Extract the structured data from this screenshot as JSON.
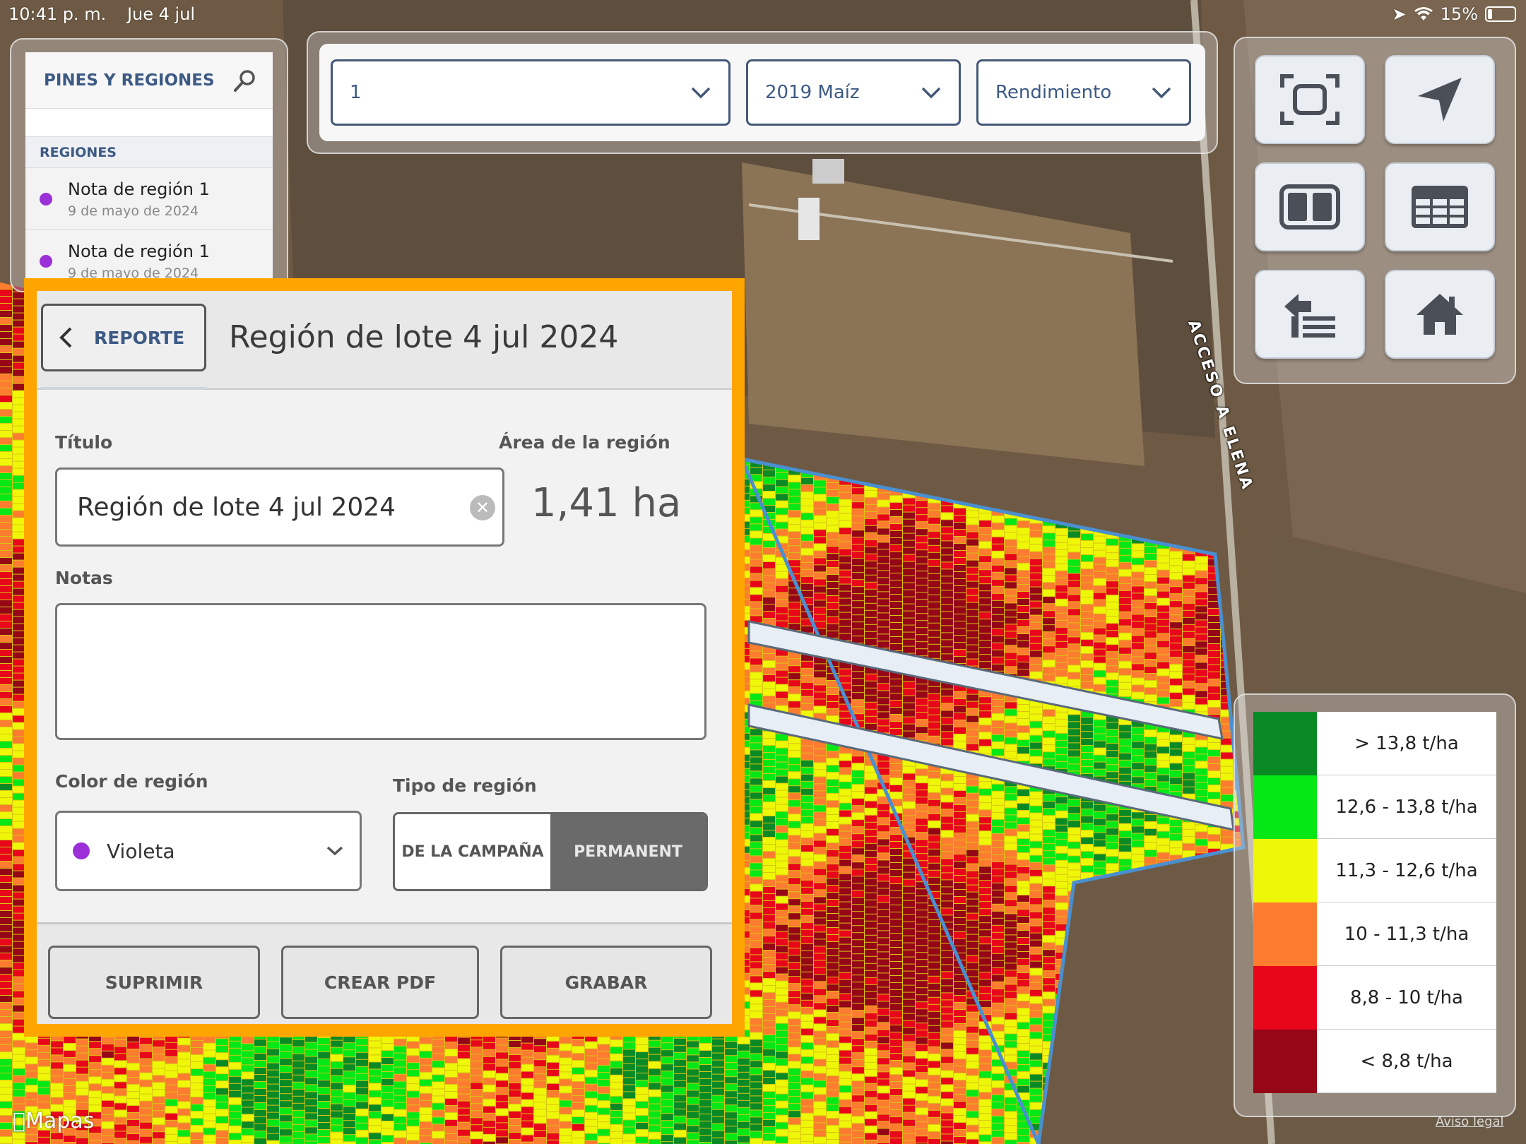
{
  "status_bar": {
    "time": "10:41 p. m.",
    "date": "Jue 4 jul",
    "battery": "15%"
  },
  "pins_panel": {
    "title": "PINES Y REGIONES",
    "regions_header": "REGIONES",
    "items": [
      {
        "name": "Nota de región 1",
        "date": "9 de mayo de 2024",
        "color": "#9b30d9"
      },
      {
        "name": "Nota de región 1",
        "date": "9 de mayo de 2024",
        "color": "#9b30d9"
      }
    ]
  },
  "selectors": {
    "field": "1",
    "season": "2019 Maíz",
    "layer": "Rendimiento"
  },
  "tools": [
    "fullscreen-icon",
    "navigate-icon",
    "split-view-icon",
    "table-icon",
    "export-list-icon",
    "home-icon"
  ],
  "legend": [
    {
      "label": "> 13,8 t/ha",
      "color": "#0a8a25"
    },
    {
      "label": "12,6 - 13,8 t/ha",
      "color": "#05e816"
    },
    {
      "label": "11,3 - 12,6 t/ha",
      "color": "#eef707"
    },
    {
      "label": "10 - 11,3 t/ha",
      "color": "#fd7c2f"
    },
    {
      "label": "8,8 - 10 t/ha",
      "color": "#e8061b"
    },
    {
      "label": "< 8,8 t/ha",
      "color": "#950617"
    }
  ],
  "map": {
    "road_label": "ACCESO A ELENA",
    "provider": "Mapas",
    "legal": "Aviso legal"
  },
  "dialog": {
    "back_label": "REPORTE",
    "header_title": "Región de lote 4 jul 2024",
    "title_label": "Título",
    "title_value": "Región de lote 4 jul 2024",
    "area_label": "Área de la región",
    "area_value": "1,41 ha",
    "notes_label": "Notas",
    "notes_value": "",
    "color_label": "Color de región",
    "color_value": "Violeta",
    "color_hex": "#9b30d9",
    "type_label": "Tipo de región",
    "type_options": [
      "DE LA CAMPAÑA",
      "PERMANENT"
    ],
    "delete_label": "SUPRIMIR",
    "pdf_label": "CREAR PDF",
    "save_label": "GRABAR"
  }
}
